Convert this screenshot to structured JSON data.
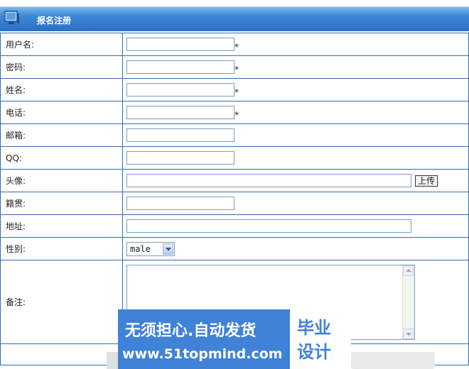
{
  "header": {
    "title": "报名注册",
    "icon": "monitor-icon"
  },
  "form": {
    "username_label": "用户名:",
    "password_label": "密码:",
    "name_label": "姓名:",
    "phone_label": "电话:",
    "email_label": "邮箱:",
    "qq_label": "QQ:",
    "avatar_label": "头像:",
    "upload_button": "上传",
    "hometown_label": "籍贯:",
    "address_label": "地址:",
    "gender_label": "性别:",
    "gender_value": "male",
    "notes_label": "备注:",
    "required_mark": "*"
  },
  "watermark": {
    "line1": "无须担心.自动发货",
    "line2": "www.51topmind.com",
    "grad1": "毕业",
    "grad2": "设计"
  },
  "colors": {
    "header_blue": "#2a6fc3",
    "border_blue": "#2f6db0",
    "watermark_blue": "#3f82d8"
  }
}
